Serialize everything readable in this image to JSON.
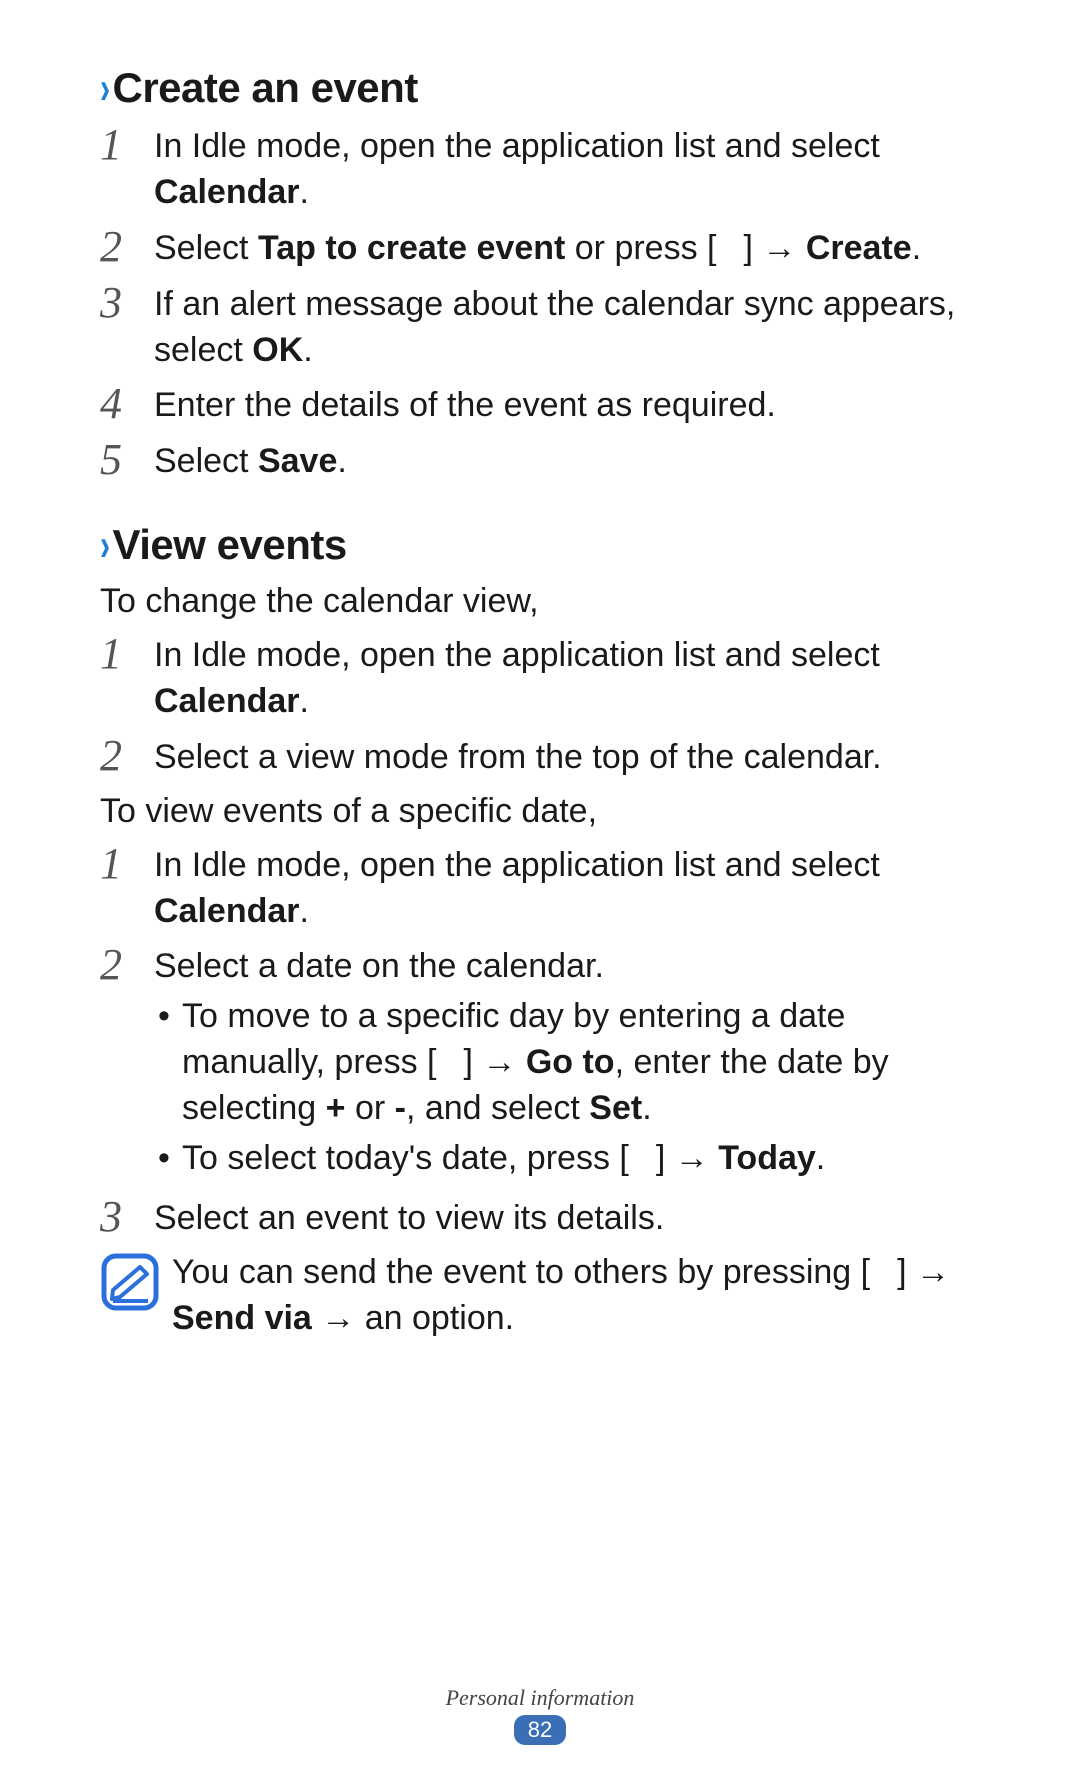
{
  "sections": {
    "create": {
      "heading": "Create an event",
      "steps": {
        "s1": {
          "num": "1",
          "pre": "In Idle mode, open the application list and select ",
          "bold1": "Calendar",
          "post": "."
        },
        "s2": {
          "num": "2",
          "pre": "Select ",
          "bold1": "Tap to create event",
          "mid": " or press [",
          "post_icon": "] → ",
          "bold2": "Create",
          "end": "."
        },
        "s3": {
          "num": "3",
          "pre": "If an alert message about the calendar sync appears, select ",
          "bold1": "OK",
          "post": "."
        },
        "s4": {
          "num": "4",
          "pre": "Enter the details of the event as required."
        },
        "s5": {
          "num": "5",
          "pre": "Select ",
          "bold1": "Save",
          "post": "."
        }
      }
    },
    "view": {
      "heading": "View events",
      "intro1": "To change the calendar view,",
      "steps1": {
        "s1": {
          "num": "1",
          "pre": "In Idle mode, open the application list and select ",
          "bold1": "Calendar",
          "post": "."
        },
        "s2": {
          "num": "2",
          "pre": "Select a view mode from the top of the calendar."
        }
      },
      "intro2": "To view events of a specific date,",
      "steps2": {
        "s1": {
          "num": "1",
          "pre": "In Idle mode, open the application list and select ",
          "bold1": "Calendar",
          "post": "."
        },
        "s2": {
          "num": "2",
          "pre": "Select a date on the calendar.",
          "bullets": {
            "b1": {
              "pre": "To move to a specific day by entering a date manually, press [",
              "post_icon": "] → ",
              "bold1": "Go to",
              "mid": ", enter the date by selecting ",
              "bold2": "+",
              "mid2": " or ",
              "bold3": "-",
              "mid3": ", and select ",
              "bold4": "Set",
              "end": "."
            },
            "b2": {
              "pre": "To select today's date, press [",
              "post_icon": "] → ",
              "bold1": "Today",
              "end": "."
            }
          }
        },
        "s3": {
          "num": "3",
          "pre": "Select an event to view its details."
        }
      },
      "note": {
        "pre": "You can send the event to others by pressing [",
        "post_icon": "] → ",
        "bold1": "Send via",
        "mid": " → an option."
      }
    }
  },
  "footer": {
    "label": "Personal information",
    "page": "82"
  }
}
